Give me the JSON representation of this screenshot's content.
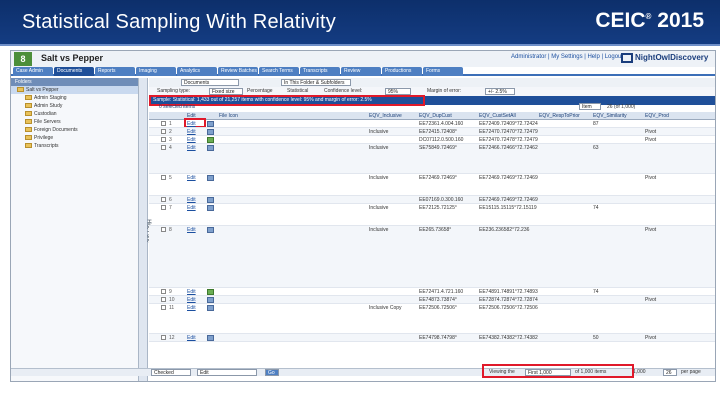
{
  "slide": {
    "title": "Statistical Sampling With Relativity",
    "brand": "CEIC",
    "brand_mark": "®",
    "brand_year": "2015"
  },
  "app": {
    "logo": "8",
    "case_name": "Salt vs Pepper",
    "user_links": "Administrator  |  My Settings  |  Help  |  Logout",
    "vendor": "NightOwlDiscovery",
    "tabs": [
      "Case Admin",
      "Documents",
      "Reports",
      "Imaging",
      "Analytics",
      "Review Batches",
      "Search Terms",
      "Transcripts",
      "Review",
      "Productions",
      "Forms"
    ],
    "active_tab": 1
  },
  "sidebar": {
    "header": "Folders",
    "folders": [
      {
        "label": "Salt vs Pepper",
        "selected": true
      },
      {
        "label": "Admin Staging",
        "selected": false
      },
      {
        "label": "Admin Study",
        "selected": false
      },
      {
        "label": "Custodian",
        "selected": false
      },
      {
        "label": "File Servers",
        "selected": false
      },
      {
        "label": "Foreign Documents",
        "selected": false
      },
      {
        "label": "Privilege",
        "selected": false
      },
      {
        "label": "Transcripts",
        "selected": false
      }
    ],
    "vertical_tab": "Hide Pane"
  },
  "toolbar": {
    "view_select": "Documents",
    "scope_select": "In This Folder & Subfolders",
    "sampling_label": "Sampling type:",
    "sampling_value": "Fixed size",
    "percentage_label": "Percentage",
    "statistical_label": "Statistical",
    "confidence_label": "Confidence level:",
    "confidence_value": "95%",
    "margin_label": "Margin of error:",
    "margin_value": "+/- 2.5%"
  },
  "filter": {
    "text": "Sample: Statistical: 1,433 out of 21,257 items with confidence level: 95% and margin of error: 2.5%",
    "selected_label": "0 selected items",
    "item_select": "Item",
    "page_count": "26 (of 1,000)"
  },
  "grid": {
    "columns": [
      "Edit",
      "File Icon",
      "EQV_Inclusive",
      "EQV_DupCust",
      "EQV_CustSetAll",
      "EQV_RespToPrior",
      "EQV_Similarity",
      "EQV_Prod"
    ],
    "rows": [
      {
        "n": "1",
        "incl": "",
        "dup": "EE72361.4.004.160",
        "cust": "EE72409.72409°72.72424",
        "sim": "87",
        "prod": "",
        "h": 8,
        "img": "blue"
      },
      {
        "n": "2",
        "incl": "Inclusive",
        "dup": "EE72415.72408°",
        "cust": "EE72470.72470°72.72479",
        "sim": "",
        "prod": "Pivot",
        "h": 8,
        "img": "blue"
      },
      {
        "n": "3",
        "incl": "",
        "dup": "DC07112.0.500.160",
        "cust": "EE72470.72478°72.72479",
        "sim": "",
        "prod": "Pivot",
        "h": 8,
        "img": "green"
      },
      {
        "n": "4",
        "incl": "Inclusive",
        "dup": "SE75849.72469°",
        "cust": "EE72466.72466°72.72462",
        "sim": "63",
        "prod": "",
        "h": 30,
        "img": "blue"
      },
      {
        "n": "5",
        "incl": "Inclusive",
        "dup": "EE72469.72469°",
        "cust": "EE72469.72469°72.72469",
        "sim": "",
        "prod": "Pivot",
        "h": 22,
        "img": "blue"
      },
      {
        "n": "6",
        "incl": "",
        "dup": "EE07169.0.300.160",
        "cust": "EE72469.72469°72.72469",
        "sim": "",
        "prod": "",
        "h": 8,
        "img": "blue"
      },
      {
        "n": "7",
        "incl": "Inclusive",
        "dup": "EE72125.72125°",
        "cust": "EE15115.15115°72.15119",
        "sim": "74",
        "prod": "",
        "h": 22,
        "img": "blue"
      },
      {
        "n": "8",
        "incl": "Inclusive",
        "dup": "EE265.73658°",
        "cust": "EE236.236582°72.236",
        "sim": "",
        "prod": "Pivot",
        "h": 62,
        "img": "blue"
      },
      {
        "n": "9",
        "incl": "",
        "dup": "EE72471.4.721.160",
        "cust": "EE74891.74891°72.74893",
        "sim": "74",
        "prod": "",
        "h": 8,
        "img": "green"
      },
      {
        "n": "10",
        "incl": "",
        "dup": "EE74873.73874°",
        "cust": "EE72874.72874°72.72874",
        "sim": "",
        "prod": "Pivot",
        "h": 8,
        "img": "blue"
      },
      {
        "n": "11",
        "incl": "Inclusive Copy",
        "dup": "EE72506.72506°",
        "cust": "EE72506.72506°72.72506",
        "sim": "",
        "prod": "",
        "h": 30,
        "img": "blue"
      },
      {
        "n": "12",
        "incl": "",
        "dup": "EE74798.74798°",
        "cust": "EE74382.74382°72.74382",
        "sim": "50",
        "prod": "Pivot",
        "h": 8,
        "img": "blue"
      }
    ]
  },
  "status": {
    "left_select": "Checked",
    "right_select": "Edit",
    "go": "Go",
    "viewing_label": "Viewing the",
    "viewing_value": "First 1,000",
    "of_label": "of 1,000 items",
    "per_page": "26",
    "per_page_label": "per page",
    "total": "1,000"
  },
  "colors": {
    "header_bg": "#0d2f6b",
    "accent": "#1f4f99",
    "highlight": "#e0192a"
  }
}
